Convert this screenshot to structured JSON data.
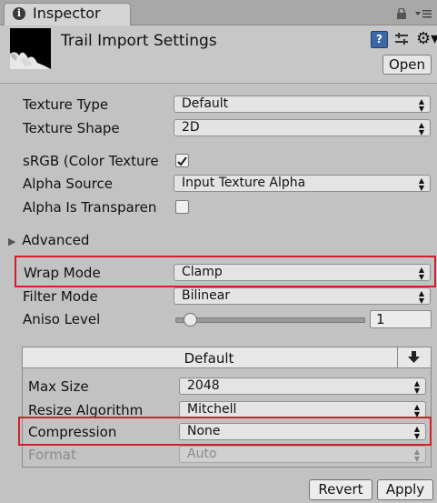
{
  "tab": {
    "label": "Inspector",
    "icon": "info-icon"
  },
  "header": {
    "title": "Trail Import Settings",
    "open_label": "Open",
    "icons": [
      "help-icon",
      "preset-icon",
      "gear-icon"
    ]
  },
  "fields": {
    "texture_type": {
      "label": "Texture Type",
      "value": "Default"
    },
    "texture_shape": {
      "label": "Texture Shape",
      "value": "2D"
    },
    "srgb": {
      "label": "sRGB (Color Texture",
      "checked": true
    },
    "alpha_source": {
      "label": "Alpha Source",
      "value": "Input Texture Alpha"
    },
    "alpha_transparency": {
      "label": "Alpha Is Transparen",
      "checked": false
    },
    "advanced": {
      "label": "Advanced"
    },
    "wrap_mode": {
      "label": "Wrap Mode",
      "value": "Clamp"
    },
    "filter_mode": {
      "label": "Filter Mode",
      "value": "Bilinear"
    },
    "aniso_level": {
      "label": "Aniso Level",
      "value": "1",
      "slider_fraction": 0.0
    }
  },
  "platform": {
    "tab_label": "Default",
    "max_size": {
      "label": "Max Size",
      "value": "2048"
    },
    "resize_algorithm": {
      "label": "Resize Algorithm",
      "value": "Mitchell"
    },
    "compression": {
      "label": "Compression",
      "value": "None"
    },
    "format": {
      "label": "Format",
      "value": "Auto"
    }
  },
  "buttons": {
    "revert": "Revert",
    "apply": "Apply"
  },
  "colors": {
    "highlight": "#d11f2b",
    "background": "#c2c2c2"
  }
}
